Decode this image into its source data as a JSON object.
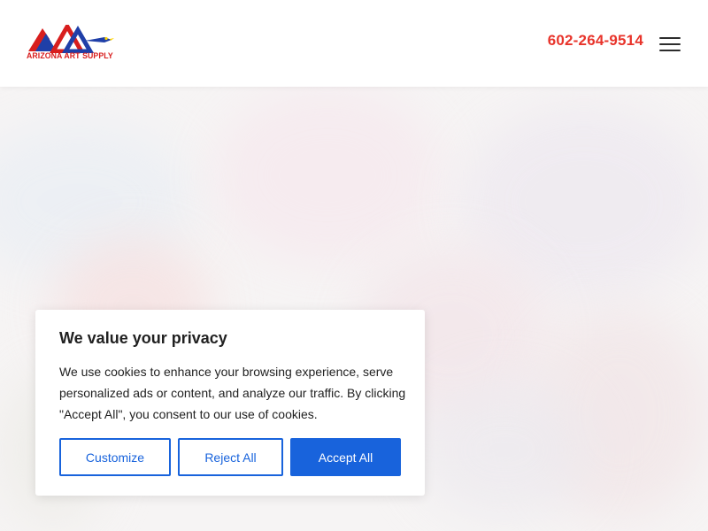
{
  "header": {
    "logo_text": "ARIZONA ART SUPPLY",
    "phone": "602-264-9514",
    "menu_icon": "hamburger-menu-icon"
  },
  "cookie_banner": {
    "title": "We value your privacy",
    "text": "We use cookies to enhance your browsing experience, serve personalized ads or content, and analyze our traffic. By clicking \"Accept All\", you consent to our use of cookies.",
    "customize_label": "Customize",
    "reject_label": "Reject All",
    "accept_label": "Accept All"
  },
  "colors": {
    "accent_red": "#e8342b",
    "button_blue": "#1863dc",
    "text_dark": "#212121",
    "logo_blue": "#1f3fa8",
    "logo_red": "#d81e1e"
  }
}
